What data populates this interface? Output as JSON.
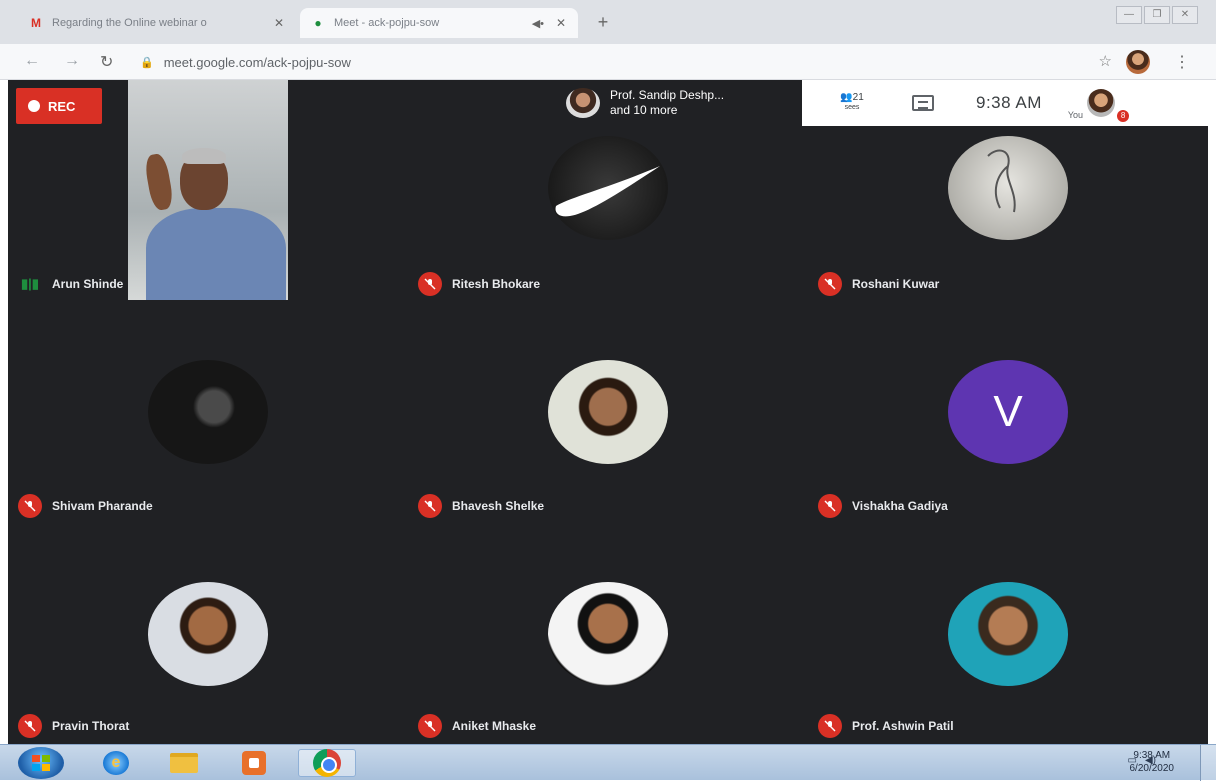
{
  "browser": {
    "tabs": [
      {
        "title": "Regarding the Online webinar o",
        "active": false
      },
      {
        "title": "Meet - ack-pojpu-sow",
        "active": true
      }
    ],
    "url": "meet.google.com/ack-pojpu-sow"
  },
  "meet": {
    "rec_label": "REC",
    "presenting": {
      "line1": "Prof. Sandip Deshp...",
      "line2": "and 10 more"
    },
    "people_count": "21",
    "people_label": "sees",
    "time": "9:38 AM",
    "you_label": "You",
    "badge": "8",
    "participants": [
      {
        "name": "Arun Shinde",
        "status": "speaking"
      },
      {
        "name": "Ritesh Bhokare",
        "status": "muted"
      },
      {
        "name": "Roshani Kuwar",
        "status": "muted"
      },
      {
        "name": "Shivam Pharande",
        "status": "muted"
      },
      {
        "name": "Bhavesh Shelke",
        "status": "muted"
      },
      {
        "name": "Vishakha Gadiya",
        "status": "muted",
        "initial": "V"
      },
      {
        "name": "Pravin Thorat",
        "status": "muted"
      },
      {
        "name": "Aniket Mhaske",
        "status": "muted"
      },
      {
        "name": "Prof. Ashwin Patil",
        "status": "muted"
      }
    ]
  },
  "taskbar": {
    "time": "9:38 AM",
    "date": "6/20/2020"
  },
  "colors": {
    "mic_muted": "#d93025",
    "stage_bg": "#202124",
    "avatar_v": "#5e35b1"
  }
}
